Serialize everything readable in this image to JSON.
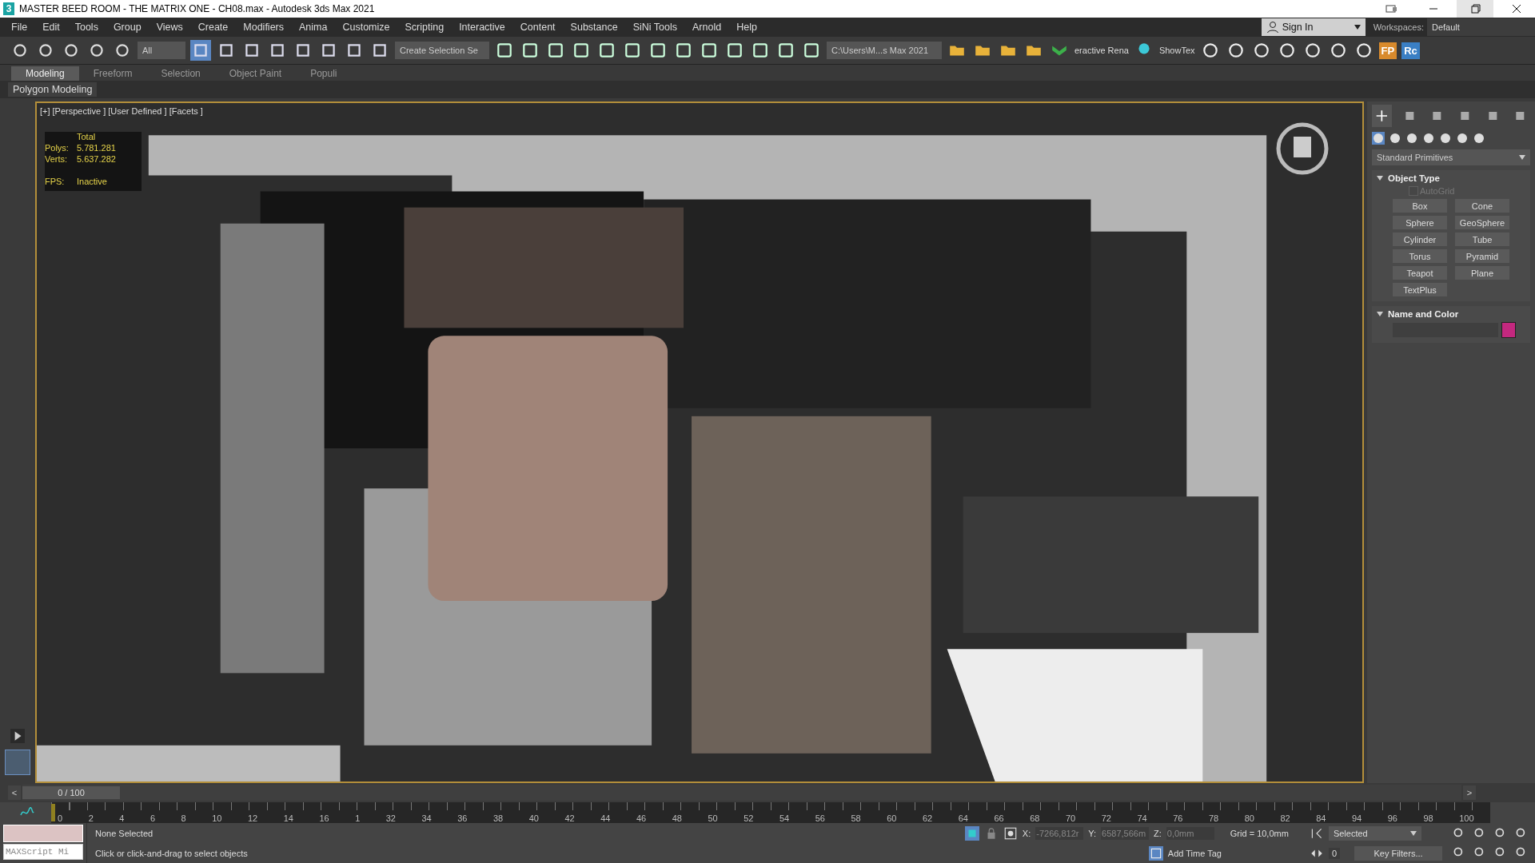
{
  "window": {
    "app_icon": "3",
    "title": "MASTER BEED ROOM - THE MATRIX ONE - CH08.max - Autodesk 3ds Max 2021"
  },
  "menu": [
    "File",
    "Edit",
    "Tools",
    "Group",
    "Views",
    "Create",
    "Modifiers",
    "Anima",
    "Customize",
    "Scripting",
    "Interactive",
    "Content",
    "Substance",
    "SiNi Tools",
    "Arnold",
    "Help"
  ],
  "account": {
    "sign_in": "Sign In",
    "workspaces_label": "Workspaces:",
    "workspace": "Default"
  },
  "toolbar": {
    "filter": "All",
    "selection_set": "Create Selection Se",
    "project_path": "C:\\Users\\M...s Max 2021",
    "render_label": "eractive Rena",
    "showtex": "ShowTex",
    "fp": "FP",
    "rc": "Rc"
  },
  "ribbon_tabs": [
    {
      "label": "Modeling",
      "selected": true
    },
    {
      "label": "Freeform",
      "selected": false
    },
    {
      "label": "Selection",
      "selected": false
    },
    {
      "label": "Object Paint",
      "selected": false
    },
    {
      "label": "Populi",
      "selected": false
    }
  ],
  "ribbon_panel": "Polygon Modeling",
  "viewport": {
    "label": "[+] [Perspective ] [User Defined ] [Facets ]",
    "stats_heading": "Total",
    "stats": [
      {
        "name": "Polys:",
        "value": "5.781.281"
      },
      {
        "name": "Verts:",
        "value": "5.637.282"
      },
      {
        "name": "FPS:",
        "value": "Inactive"
      }
    ]
  },
  "command_panel": {
    "category": "Standard Primitives",
    "object_type": {
      "title": "Object Type",
      "autogrid": {
        "label": "AutoGrid",
        "checked": false,
        "disabled": true
      },
      "buttons": [
        "Box",
        "Cone",
        "Sphere",
        "GeoSphere",
        "Cylinder",
        "Tube",
        "Torus",
        "Pyramid",
        "Teapot",
        "Plane",
        "TextPlus"
      ]
    },
    "name_and_color": {
      "title": "Name and Color",
      "color": "#c4287f"
    }
  },
  "time_slider": {
    "prev": "<",
    "position": "0 / 100",
    "next": ">",
    "level": 0
  },
  "ruler_labels": [
    "0",
    "2",
    "4",
    "6",
    "8",
    "10",
    "12",
    "14",
    "16",
    "1",
    "32",
    "34",
    "36",
    "38",
    "40",
    "42",
    "44",
    "46",
    "48",
    "50",
    "52",
    "54",
    "56",
    "58",
    "60",
    "62",
    "64",
    "66",
    "68",
    "70",
    "72",
    "74",
    "76",
    "78",
    "80",
    "82",
    "84",
    "94",
    "96",
    "98",
    "100"
  ],
  "status_bar": {
    "listener_placeholder": "MAXScript Mi",
    "selection": "None Selected",
    "prompt": "Click or click-and-drag to select objects",
    "x_label": "X:",
    "x": "-7266,812r",
    "y_label": "Y:",
    "y": "6587,566m",
    "z_label": "Z:",
    "z": "0,0mm",
    "grid": "Grid = 10,0mm",
    "add_time_tag": "Add Time Tag",
    "key_mode": "Selected",
    "frame": "0",
    "key_filters": "Key Filters..."
  }
}
